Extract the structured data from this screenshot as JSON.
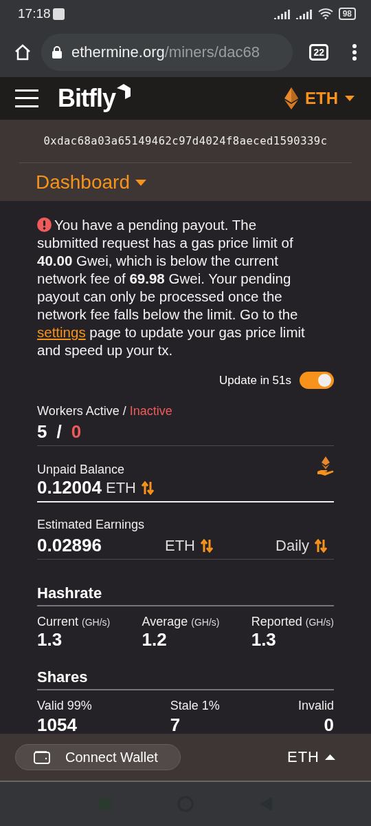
{
  "status_bar": {
    "time": "17:18",
    "battery": "98"
  },
  "browser": {
    "url_host": "ethermine.org",
    "url_path": "/miners/dac68",
    "tab_count": "22"
  },
  "header": {
    "logo": "Bitfly",
    "currency": "ETH"
  },
  "miner": {
    "address": "0xdac68a03a65149462c97d4024f8aeced1590339c",
    "page": "Dashboard"
  },
  "alert": {
    "text_before": "You have a pending payout. The submitted request has a gas price limit of **40.00** Gwei, which is below the current network fee of **69.98** Gwei. Your pending payout can only be processed once the network fee falls below the limit. Go to the",
    "link": "settings",
    "text_after": "page to update your gas price limit and speed up your tx."
  },
  "auto_update": {
    "label": "Update in 51s",
    "on": true
  },
  "workers": {
    "active_label": "Workers Active /",
    "inactive_label": "Inactive",
    "active": "5",
    "separator": "/",
    "inactive": "0"
  },
  "unpaid_balance": {
    "label": "Unpaid Balance",
    "value": "0.12004",
    "unit": "ETH"
  },
  "estimated_earnings": {
    "label": "Estimated Earnings",
    "value": "0.02896",
    "unit": "ETH",
    "period": "Daily"
  },
  "hashrate": {
    "title": "Hashrate",
    "items": [
      {
        "label": "Current",
        "unit": "(GH/s)",
        "value": "1.3"
      },
      {
        "label": "Average",
        "unit": "(GH/s)",
        "value": "1.2"
      },
      {
        "label": "Reported",
        "unit": "(GH/s)",
        "value": "1.3"
      }
    ]
  },
  "shares": {
    "title": "Shares",
    "items": [
      {
        "label": "Valid 99%",
        "value": "1054"
      },
      {
        "label": "Stale 1%",
        "value": "7"
      },
      {
        "label": "Invalid",
        "value": "0"
      }
    ]
  },
  "footer": {
    "wallet_button": "Connect Wallet",
    "currency": "ETH"
  }
}
